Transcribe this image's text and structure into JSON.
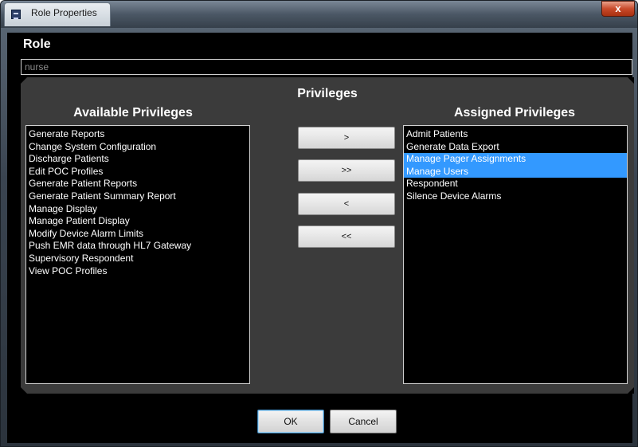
{
  "window": {
    "title": "Role Properties",
    "close_label": "x"
  },
  "role": {
    "label": "Role",
    "value": "nurse"
  },
  "privileges": {
    "title": "Privileges",
    "available_title": "Available Privileges",
    "assigned_title": "Assigned Privileges",
    "available": [
      "Generate Reports",
      "Change System Configuration",
      "Discharge Patients",
      "Edit POC Profiles",
      "Generate Patient Reports",
      "Generate Patient Summary Report",
      "Manage Display",
      "Manage Patient Display",
      "Modify Device Alarm Limits",
      "Push EMR data through HL7 Gateway",
      "Supervisory Respondent",
      "View POC Profiles"
    ],
    "assigned": [
      "Admit Patients",
      "Generate Data Export",
      "Manage Pager Assignments",
      "Manage Users",
      "Respondent",
      "Silence Device Alarms"
    ],
    "selected_assigned": [
      "Manage Pager Assignments",
      "Manage Users"
    ]
  },
  "transfer_buttons": {
    "add": ">",
    "add_all": ">>",
    "remove": "<",
    "remove_all": "<<"
  },
  "dialog_buttons": {
    "ok": "OK",
    "cancel": "Cancel"
  },
  "colors": {
    "selection": "#3399ff",
    "background": "#000000",
    "panel": "#3b3b3b"
  }
}
